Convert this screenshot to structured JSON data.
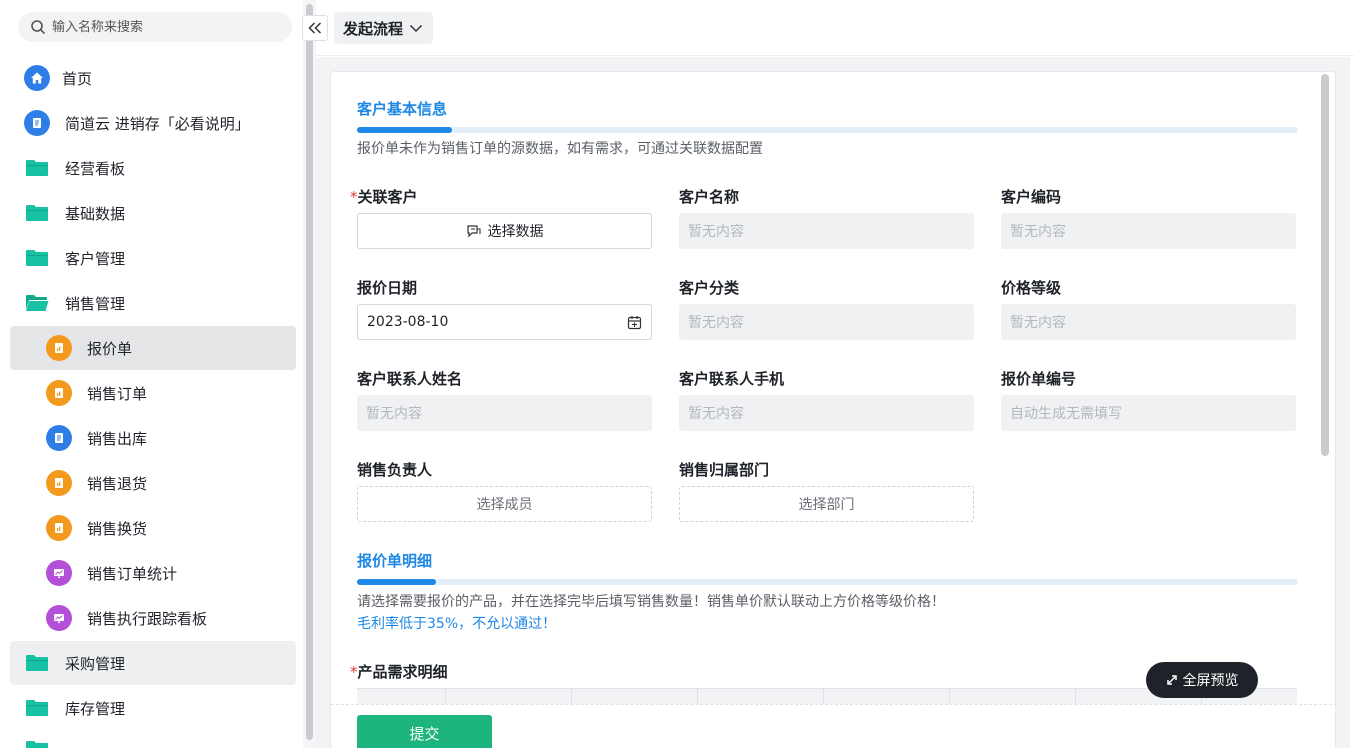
{
  "sidebar": {
    "search_placeholder": "输入名称来搜索",
    "items": [
      {
        "label": "首页",
        "icon": "home-icon"
      },
      {
        "label": "简道云 进销存「必看说明」",
        "icon": "document-icon"
      },
      {
        "label": "经营看板",
        "icon": "folder-icon"
      },
      {
        "label": "基础数据",
        "icon": "folder-icon"
      },
      {
        "label": "客户管理",
        "icon": "folder-icon"
      },
      {
        "label": "销售管理",
        "icon": "folder-open-icon"
      },
      {
        "label": "报价单",
        "icon": "form-icon"
      },
      {
        "label": "销售订单",
        "icon": "form-icon"
      },
      {
        "label": "销售出库",
        "icon": "document-icon"
      },
      {
        "label": "销售退货",
        "icon": "form-icon"
      },
      {
        "label": "销售换货",
        "icon": "form-icon"
      },
      {
        "label": "销售订单统计",
        "icon": "dashboard-icon"
      },
      {
        "label": "销售执行跟踪看板",
        "icon": "dashboard-icon"
      },
      {
        "label": "采购管理",
        "icon": "folder-icon"
      },
      {
        "label": "库存管理",
        "icon": "folder-icon"
      }
    ]
  },
  "topbar": {
    "flow_label": "发起流程"
  },
  "form": {
    "section1": {
      "title": "客户基本信息",
      "desc": "报价单未作为销售订单的源数据，如有需求，可通过关联数据配置"
    },
    "fields": {
      "linked_customer": {
        "label": "关联客户",
        "button": "选择数据"
      },
      "customer_name": {
        "label": "客户名称",
        "placeholder": "暂无内容"
      },
      "customer_code": {
        "label": "客户编码",
        "placeholder": "暂无内容"
      },
      "quote_date": {
        "label": "报价日期",
        "value": "2023-08-10"
      },
      "customer_category": {
        "label": "客户分类",
        "placeholder": "暂无内容"
      },
      "price_level": {
        "label": "价格等级",
        "placeholder": "暂无内容"
      },
      "contact_name": {
        "label": "客户联系人姓名",
        "placeholder": "暂无内容"
      },
      "contact_phone": {
        "label": "客户联系人手机",
        "placeholder": "暂无内容"
      },
      "quote_number": {
        "label": "报价单编号",
        "placeholder": "自动生成无需填写"
      },
      "sales_owner": {
        "label": "销售负责人",
        "button": "选择成员"
      },
      "sales_dept": {
        "label": "销售归属部门",
        "button": "选择部门"
      }
    },
    "section2": {
      "title": "报价单明细",
      "desc": "请选择需要报价的产品，并在选择完毕后填写销售数量！销售单价默认联动上方价格等级价格！",
      "warning": "毛利率低于35%，不允以通过！"
    },
    "product_detail_label": "产品需求明细",
    "submit_label": "提交",
    "fullscreen_label": "全屏预览"
  },
  "colors": {
    "accent_blue": "#1e88e5",
    "submit_green": "#1db47d",
    "folder_teal": "#17c2a4",
    "icon_orange": "#f39a1e",
    "icon_blue": "#2f7ee8",
    "icon_purple": "#b44fd8"
  }
}
